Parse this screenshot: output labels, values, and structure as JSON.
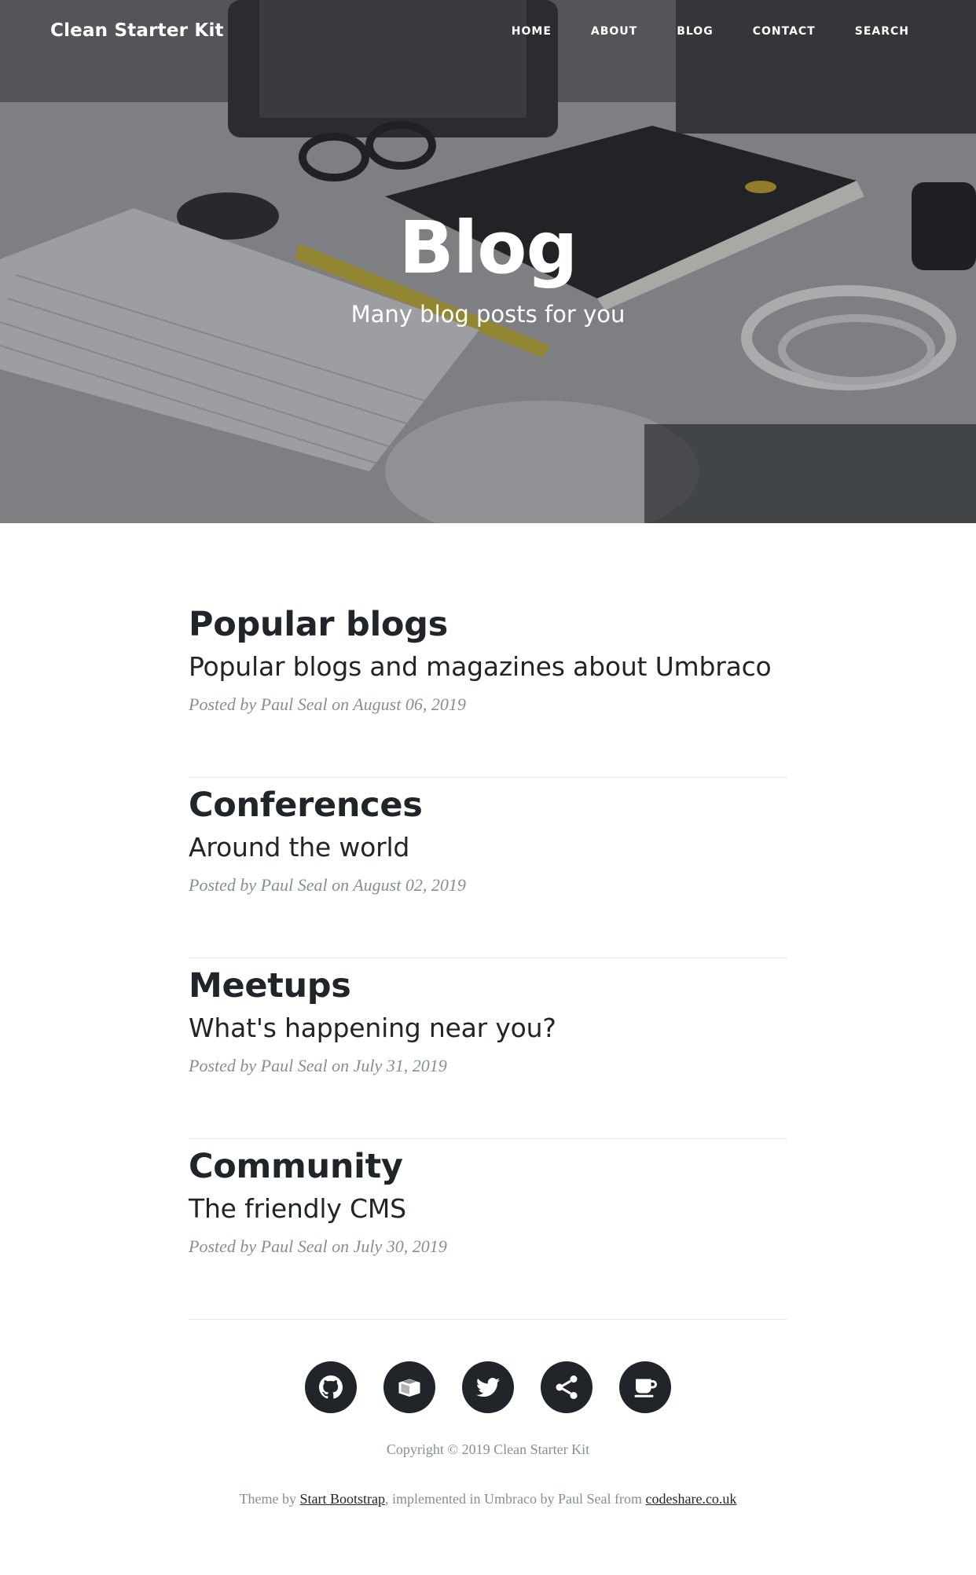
{
  "nav": {
    "brand": "Clean Starter Kit",
    "items": [
      {
        "label": "HOME"
      },
      {
        "label": "ABOUT"
      },
      {
        "label": "BLOG"
      },
      {
        "label": "CONTACT"
      },
      {
        "label": "SEARCH"
      }
    ]
  },
  "hero": {
    "title": "Blog",
    "subtitle": "Many blog posts for you"
  },
  "posts": [
    {
      "title": "Popular blogs",
      "subtitle": "Popular blogs and magazines about Umbraco",
      "meta_prefix": "Posted by",
      "author": "Paul Seal",
      "meta_on": "on",
      "date": "August 06, 2019"
    },
    {
      "title": "Conferences",
      "subtitle": "Around the world",
      "meta_prefix": "Posted by",
      "author": "Paul Seal",
      "meta_on": "on",
      "date": "August 02, 2019"
    },
    {
      "title": "Meetups",
      "subtitle": "What's happening near you?",
      "meta_prefix": "Posted by",
      "author": "Paul Seal",
      "meta_on": "on",
      "date": "July 31, 2019"
    },
    {
      "title": "Community",
      "subtitle": "The friendly CMS",
      "meta_prefix": "Posted by",
      "author": "Paul Seal",
      "meta_on": "on",
      "date": "July 30, 2019"
    }
  ],
  "footer": {
    "socials": [
      {
        "icon": "github-icon"
      },
      {
        "icon": "package-icon"
      },
      {
        "icon": "twitter-icon"
      },
      {
        "icon": "share-icon"
      },
      {
        "icon": "coffee-icon"
      }
    ],
    "copyright": "Copyright © 2019 Clean Starter Kit",
    "credits_prefix": "Theme by",
    "credits_link1": "Start Bootstrap",
    "credits_middle": ", implemented in Umbraco by Paul Seal from",
    "credits_link2": "codeshare.co.uk"
  },
  "colors": {
    "text": "#212529",
    "muted": "#868e96",
    "divider": "#e9ecef",
    "hero_overlay": "#232528"
  }
}
